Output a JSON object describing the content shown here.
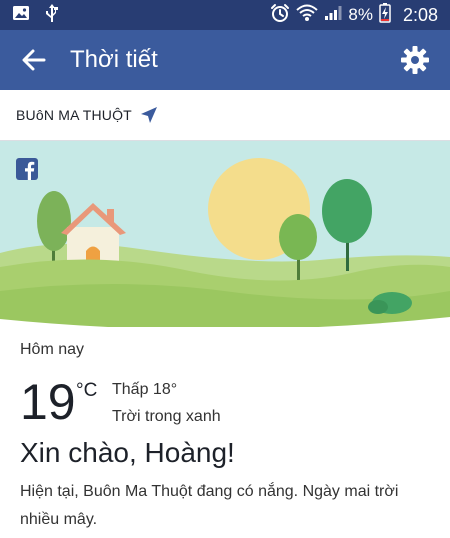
{
  "status_bar": {
    "battery_percent": "8%",
    "time": "2:08",
    "icons": [
      "image-icon",
      "usb-icon",
      "alarm-icon",
      "wifi-icon",
      "signal-icon",
      "battery-charging-icon"
    ]
  },
  "app_bar": {
    "title": "Thời tiết",
    "back_icon": "arrow-left-icon",
    "settings_icon": "gear-icon"
  },
  "location": {
    "name": "BUôN MA THUỘT",
    "icon": "location-arrow-icon"
  },
  "weather": {
    "today_label": "Hôm nay",
    "temperature": "19",
    "unit": "°C",
    "low": "Thấp 18°",
    "condition": "Trời trong xanh",
    "greeting": "Xin chào, Hoàng!",
    "description": "Hiện tại, Buôn Ma Thuột đang có nắng. Ngày mai trời nhiều mây."
  },
  "colors": {
    "status_bar": "#283d73",
    "app_bar": "#3b5b9d",
    "sky": "#c6e9e6",
    "sun": "#f4dd8c",
    "hills": "#a9cf6e",
    "accent_blue": "#3b5998"
  }
}
